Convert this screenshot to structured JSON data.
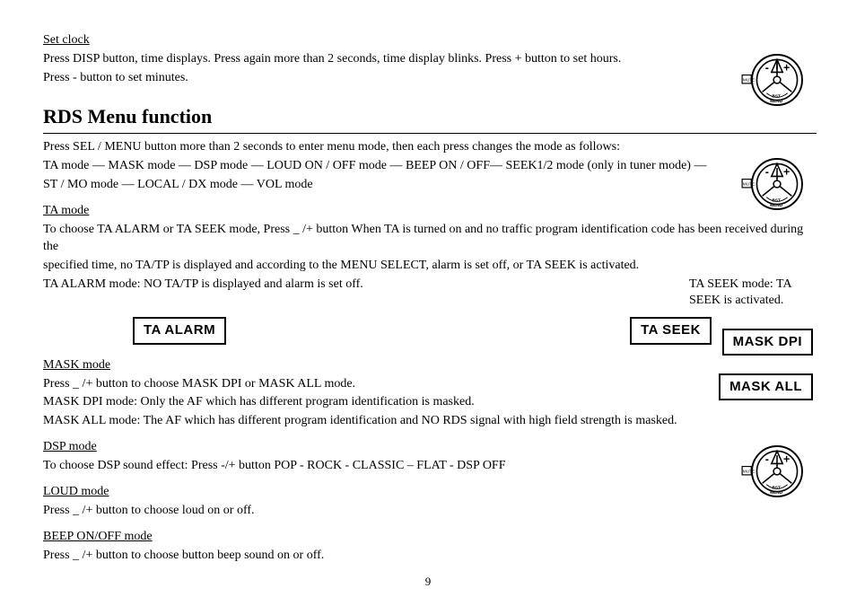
{
  "set_clock": {
    "heading": "Set clock",
    "line1": "Press DISP button, time displays. Press again more than 2 seconds, time display blinks. Press + button to set hours.",
    "line2": "Press - button to set minutes."
  },
  "rds": {
    "heading": "RDS Menu function",
    "intro1": "Press SEL / MENU button more than 2 seconds to enter menu mode, then each press changes the mode as follows:",
    "intro2": "TA mode — MASK mode — DSP mode — LOUD ON / OFF mode — BEEP ON / OFF— SEEK1/2 mode (only in tuner mode) —",
    "intro3": "ST / MO mode — LOCAL / DX mode — VOL mode"
  },
  "ta": {
    "heading": "TA mode",
    "line1": "To choose TA ALARM or TA SEEK mode, Press _ /+ button When TA is turned on and no traffic program identification code has been received during the",
    "line2": "specified time, no TA/TP is displayed and according to the MENU SELECT, alarm is set off, or TA SEEK is activated.",
    "alarm_mode": "TA ALARM mode: NO TA/TP is displayed and alarm is set off.",
    "seek_mode": "TA SEEK mode: TA SEEK is activated.",
    "label_alarm": "TA ALARM",
    "label_seek": "TA  SEEK"
  },
  "mask": {
    "heading": "MASK mode",
    "line1": "Press _ /+ button to choose MASK DPI or MASK ALL mode.",
    "line2": "MASK DPI mode: Only the AF which has different program identification is masked.",
    "line3": "MASK ALL mode: The AF which has different program identification and NO RDS signal with high field strength is masked.",
    "label_dpi": "MASK   DPI",
    "label_all": "MASK   ALL"
  },
  "dsp": {
    "heading": "DSP mode ",
    "line1": "To choose DSP sound effect: Press -/+ button POP - ROCK - CLASSIC – FLAT - DSP OFF"
  },
  "loud": {
    "heading": "LOUD mode ",
    "line1": "Press _ /+ button to choose loud on or off."
  },
  "beep": {
    "heading": "BEEP ON/OFF mode ",
    "line1": "Press _ /+ button to choose button beep sound on or off."
  },
  "page_number": "9",
  "knob": {
    "minus": "-",
    "plus": "+",
    "mute": "MUTE",
    "bst": "BST",
    "menu": "MENU"
  }
}
